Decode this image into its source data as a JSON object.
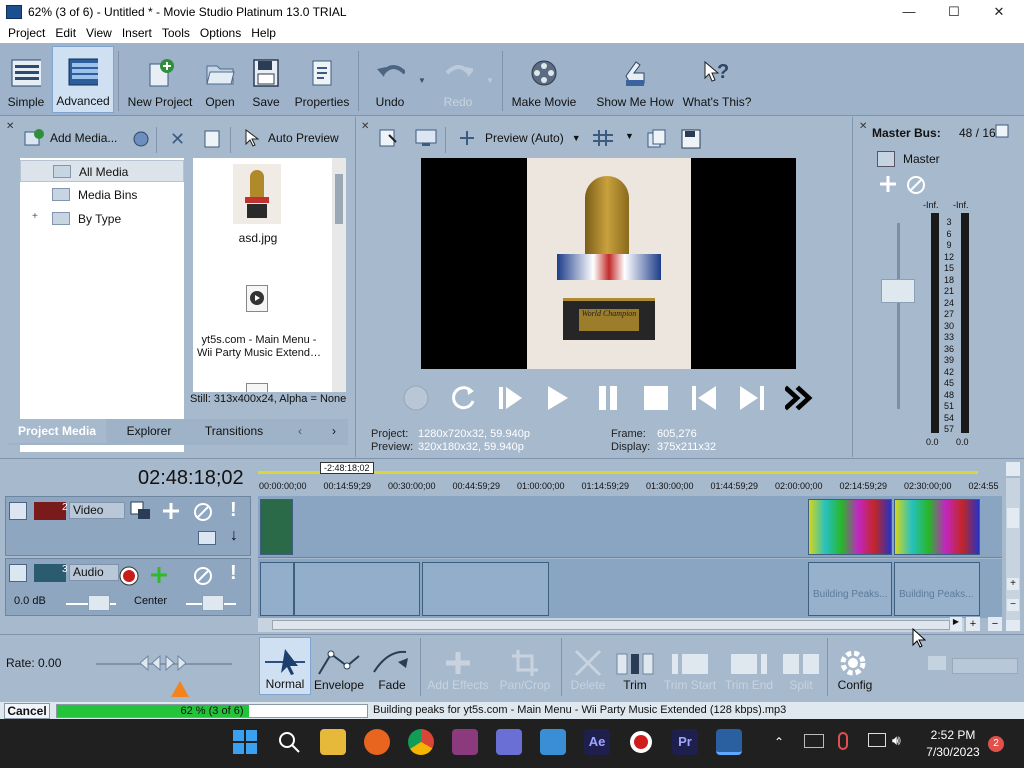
{
  "window": {
    "title": "62% (3 of 6) - Untitled * - Movie Studio Platinum 13.0 TRIAL",
    "controls": {
      "minimize": "—",
      "maximize": "☐",
      "close": "✕"
    }
  },
  "menu": [
    "Project",
    "Edit",
    "View",
    "Insert",
    "Tools",
    "Options",
    "Help"
  ],
  "toolbar": {
    "simple": "Simple",
    "advanced": "Advanced",
    "new_project": "New Project",
    "open": "Open",
    "save": "Save",
    "properties": "Properties",
    "undo": "Undo",
    "redo": "Redo",
    "make_movie": "Make Movie",
    "show_me_how": "Show Me How",
    "whats_this": "What's This?"
  },
  "media_panel": {
    "add_media": "Add Media...",
    "auto_preview": "Auto Preview",
    "tree": [
      "All Media",
      "Media Bins",
      "By Type"
    ],
    "tree_expander": "+",
    "files": [
      {
        "name": "asd.jpg"
      },
      {
        "name": "yt5s.com - Main Menu - Wii Party Music Extend…"
      }
    ],
    "status": "Still: 313x400x24, Alpha = None",
    "tabs": [
      "Project Media",
      "Explorer",
      "Transitions"
    ],
    "tab_nav": [
      "‹",
      "›"
    ]
  },
  "preview": {
    "mode": "Preview (Auto)",
    "trophy_text": "World Champion",
    "project_label": "Project:",
    "project_value": "1280x720x32, 59.940p",
    "preview_label": "Preview:",
    "preview_value": "320x180x32, 59.940p",
    "frame_label": "Frame:",
    "frame_value": "605,276",
    "display_label": "Display:",
    "display_value": "375x211x32"
  },
  "master": {
    "title": "Master Bus:",
    "value": "48 / 16",
    "label": "Master",
    "inf_left": "-Inf.",
    "inf_right": "-Inf.",
    "scale": [
      "3",
      "6",
      "9",
      "12",
      "15",
      "18",
      "21",
      "24",
      "27",
      "30",
      "33",
      "36",
      "39",
      "42",
      "45",
      "48",
      "51",
      "54",
      "57"
    ],
    "zero_left": "0.0",
    "zero_right": "0.0"
  },
  "timeline": {
    "timecode": "02:48:18;02",
    "cursor_time": "-2:48:18;02",
    "ruler": [
      "00:00:00;00",
      "00:14:59;29",
      "00:30:00;00",
      "00:44:59;29",
      "01:00:00;00",
      "01:14:59;29",
      "01:30:00;00",
      "01:44:59;29",
      "02:00:00;00",
      "02:14:59;29",
      "02:30:00;00",
      "02:4:55"
    ],
    "video_track": {
      "num": "2",
      "name": "Video"
    },
    "audio_track": {
      "num": "3",
      "name": "Audio",
      "volume": "0.0 dB",
      "pan": "Center"
    },
    "building_peaks": "Building Peaks..."
  },
  "bottom": {
    "rate": "Rate: 0.00",
    "normal": "Normal",
    "envelope": "Envelope",
    "fade": "Fade",
    "add_effects": "Add Effects",
    "pan_crop": "Pan/Crop",
    "delete": "Delete",
    "trim": "Trim",
    "trim_start": "Trim Start",
    "trim_end": "Trim End",
    "split": "Split",
    "config": "Config"
  },
  "status": {
    "cancel": "Cancel",
    "progress_text": "62 % (3 of 6)",
    "progress": 0.62,
    "message": "Building peaks for yt5s.com - Main Menu - Wii Party Music Extended (128 kbps).mp3"
  },
  "taskbar": {
    "time": "2:52 PM",
    "date": "7/30/2023",
    "notifications": "2"
  }
}
